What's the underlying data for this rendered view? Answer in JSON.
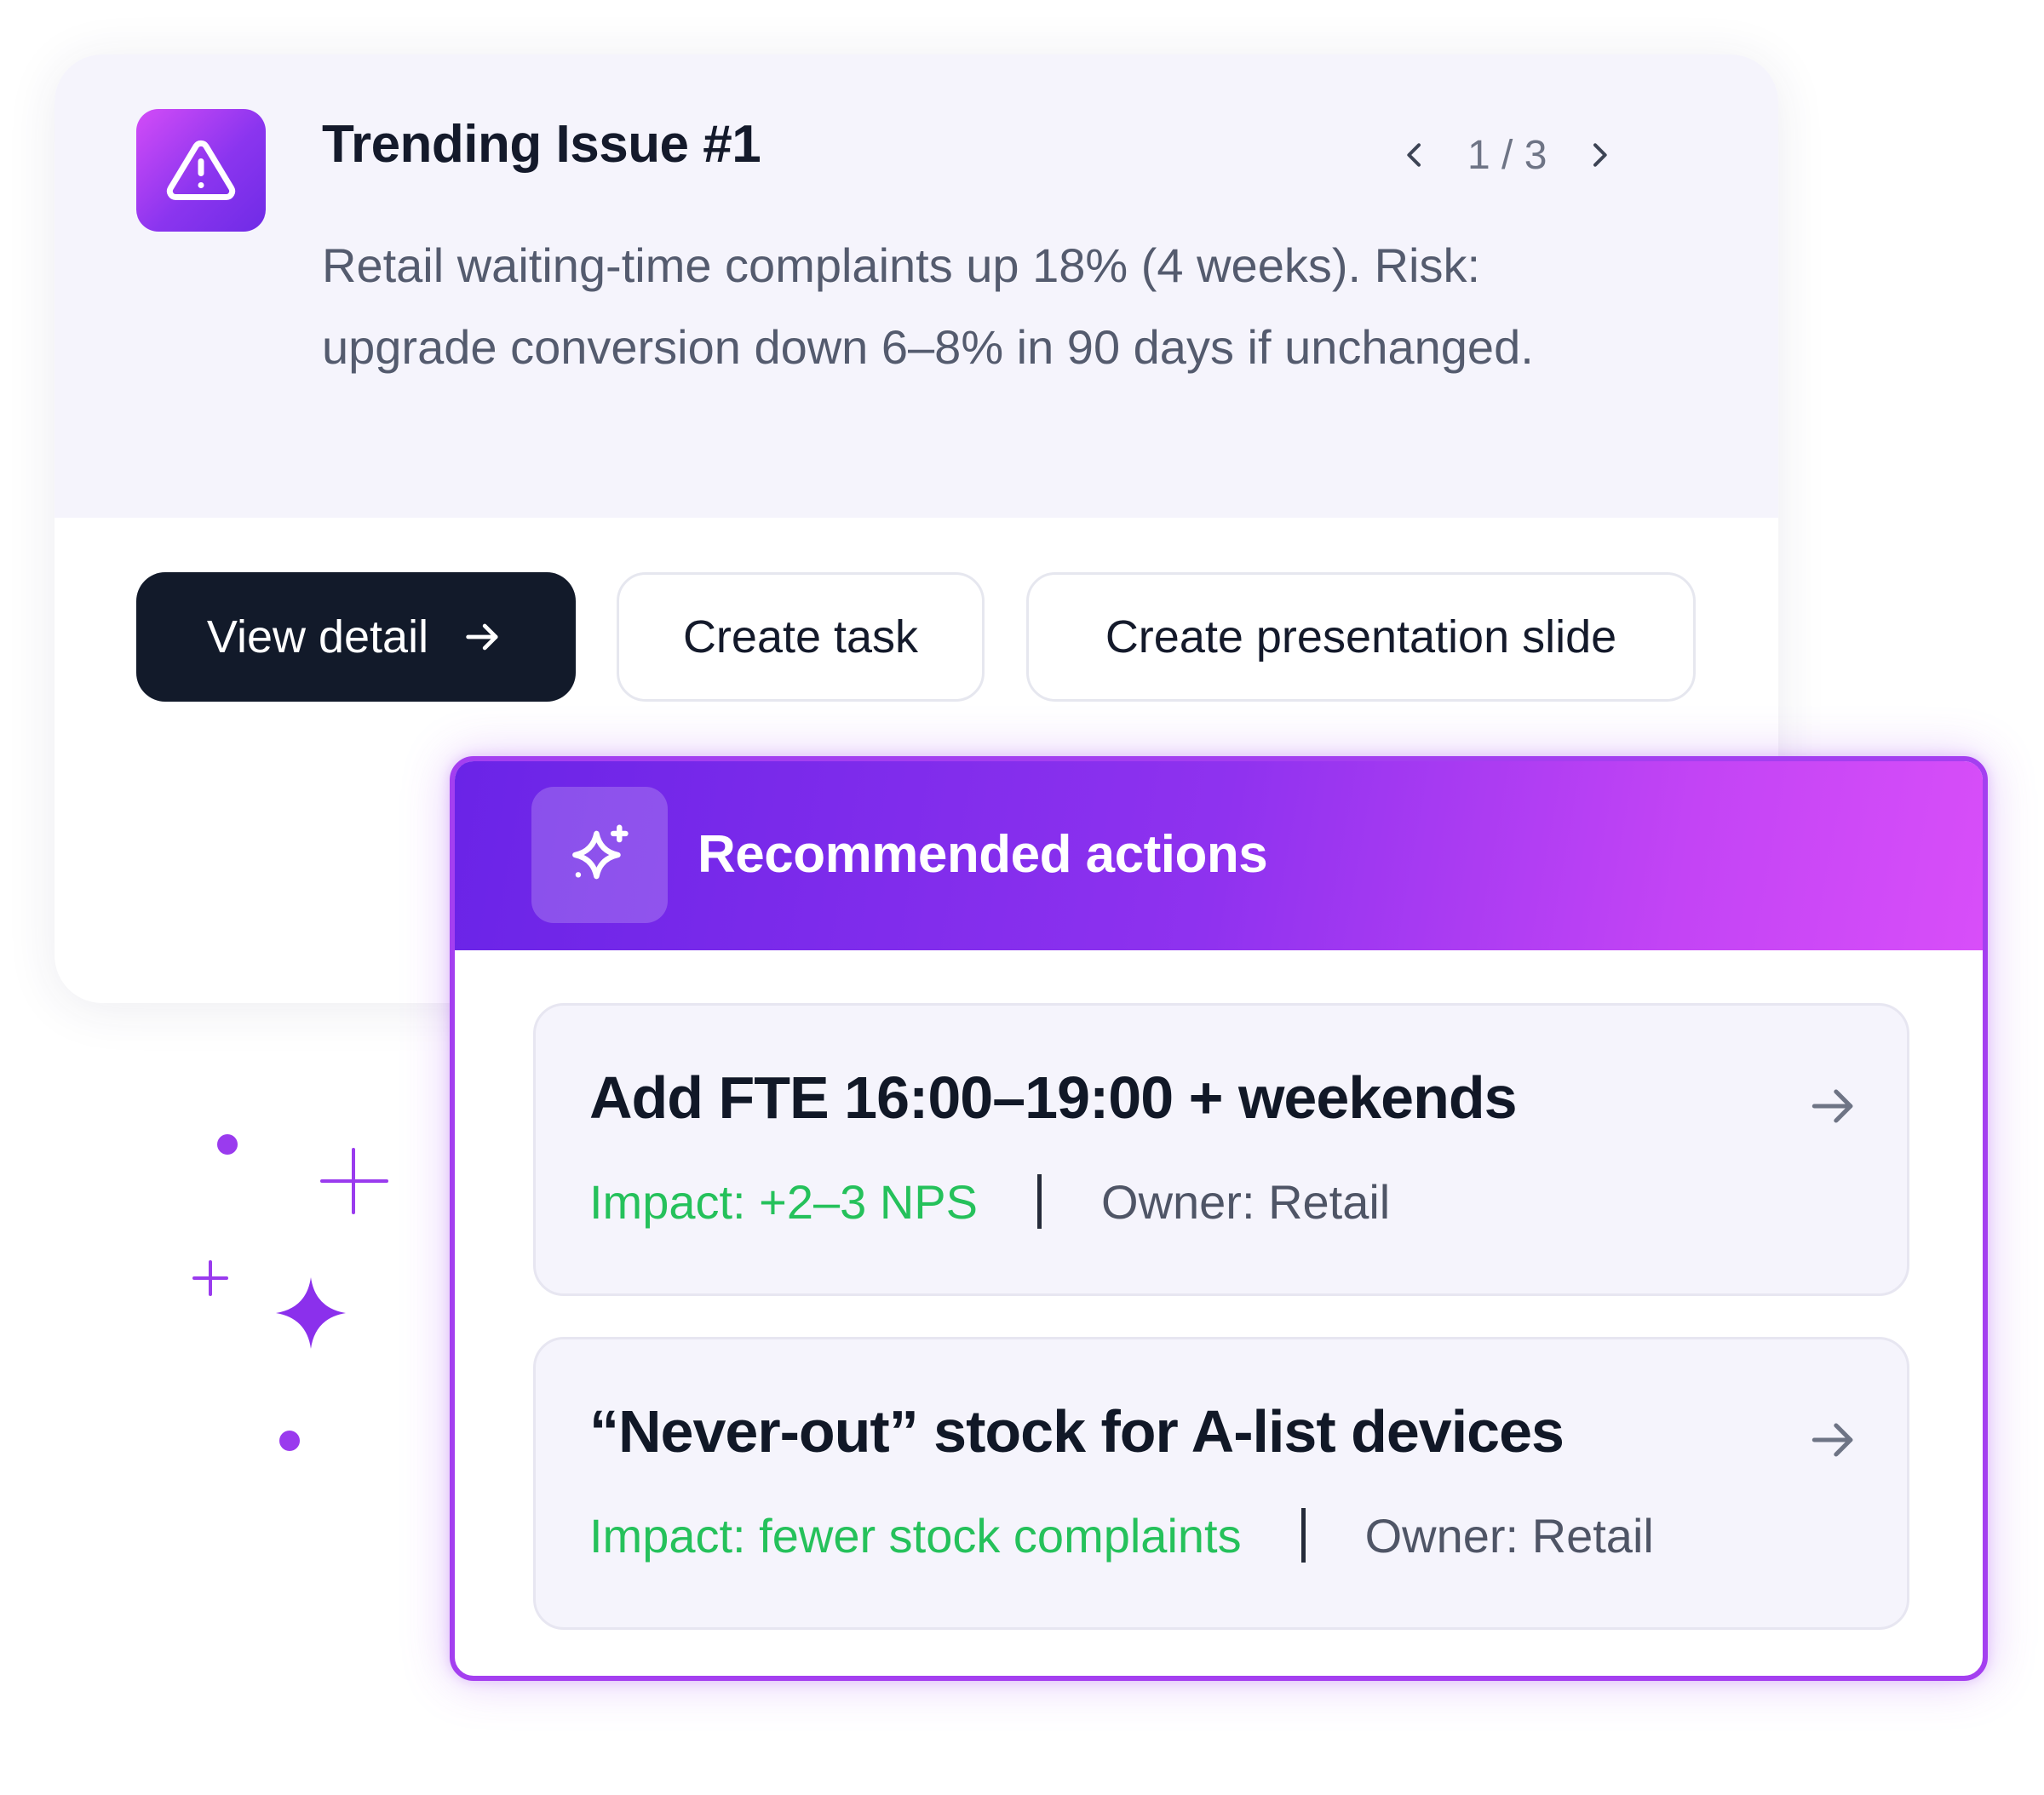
{
  "trending": {
    "title": "Trending Issue #1",
    "pager": "1 / 3",
    "description": "Retail waiting-time complaints up 18% (4 weeks). Risk: upgrade conversion down 6–8% in 90 days if unchanged.",
    "icon": "warning-triangle-icon",
    "accent": "#8b35ef"
  },
  "buttons": {
    "view_detail": "View detail",
    "create_task": "Create task",
    "create_slide": "Create presentation slide"
  },
  "recommended": {
    "title": "Recommended actions",
    "icon": "sparkle-icon",
    "actions": [
      {
        "title": "Add FTE 16:00–19:00 + weekends",
        "impact": "Impact: +2–3 NPS",
        "owner": "Owner: Retail"
      },
      {
        "title": "“Never-out” stock for A-list devices",
        "impact": "Impact: fewer stock complaints",
        "owner": "Owner: Retail"
      }
    ]
  },
  "colors": {
    "primary_button": "#121a2a",
    "impact_text": "#25c15b",
    "gradient_start": "#6a24e7",
    "gradient_end": "#d84ef9"
  }
}
